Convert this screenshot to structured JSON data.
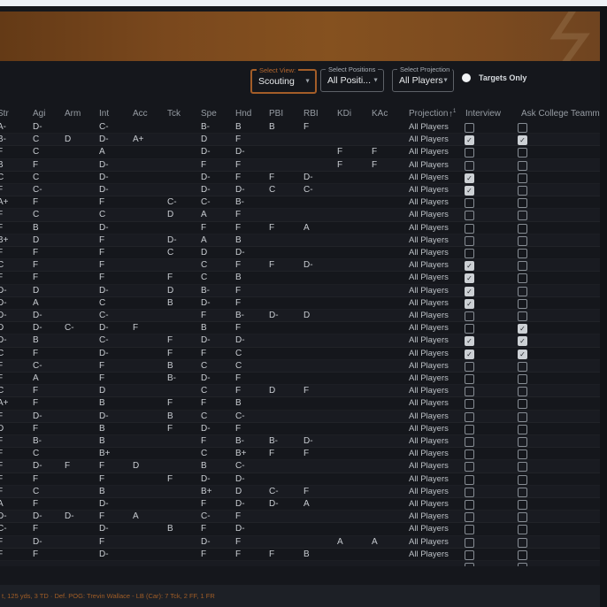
{
  "toolbar": {
    "select_view": {
      "label": "Select View:",
      "value": "Scouting"
    },
    "select_positions": {
      "label": "Select Positions",
      "value": "All Positi..."
    },
    "select_projection": {
      "label": "Select Projection",
      "value": "All Players"
    },
    "targets_only_label": "Targets Only"
  },
  "table": {
    "columns": [
      "Str",
      "Agi",
      "Arm",
      "Int",
      "Acc",
      "Tck",
      "Spe",
      "Hnd",
      "PBI",
      "RBI",
      "KDi",
      "KAc",
      "Projection"
    ],
    "sort_arrow": "↑",
    "sort_priority": "1",
    "interview_label": "Interview",
    "ask_label": "Ask College Teammates",
    "projection_value": "All Players",
    "rows": [
      {
        "g": [
          "A-",
          "D-",
          "",
          "C-",
          "",
          "",
          "B-",
          "B",
          "B",
          "F",
          "",
          ""
        ],
        "iv": false,
        "ask": false
      },
      {
        "g": [
          "B-",
          "C",
          "D",
          "D-",
          "A+",
          "",
          "D",
          "F",
          "",
          "",
          "",
          ""
        ],
        "iv": true,
        "ask": true
      },
      {
        "g": [
          "F",
          "C",
          "",
          "A",
          "",
          "",
          "D-",
          "D-",
          "",
          "",
          "F",
          "F"
        ],
        "iv": false,
        "ask": false
      },
      {
        "g": [
          "B",
          "F",
          "",
          "D-",
          "",
          "",
          "F",
          "F",
          "",
          "",
          "F",
          "F"
        ],
        "iv": false,
        "ask": false
      },
      {
        "g": [
          "C",
          "C",
          "",
          "D-",
          "",
          "",
          "D-",
          "F",
          "F",
          "D-",
          "",
          ""
        ],
        "iv": true,
        "ask": false
      },
      {
        "g": [
          "F",
          "C-",
          "",
          "D-",
          "",
          "",
          "D-",
          "D-",
          "C",
          "C-",
          "",
          ""
        ],
        "iv": true,
        "ask": false
      },
      {
        "g": [
          "A+",
          "F",
          "",
          "F",
          "",
          "C-",
          "C-",
          "B-",
          "",
          "",
          "",
          ""
        ],
        "iv": false,
        "ask": false
      },
      {
        "g": [
          "F",
          "C",
          "",
          "C",
          "",
          "D",
          "A",
          "F",
          "",
          "",
          "",
          ""
        ],
        "iv": false,
        "ask": false
      },
      {
        "g": [
          "F",
          "B",
          "",
          "D-",
          "",
          "",
          "F",
          "F",
          "F",
          "A",
          "",
          ""
        ],
        "iv": false,
        "ask": false
      },
      {
        "g": [
          "B+",
          "D",
          "",
          "F",
          "",
          "D-",
          "A",
          "B",
          "",
          "",
          "",
          ""
        ],
        "iv": false,
        "ask": false
      },
      {
        "g": [
          "F",
          "F",
          "",
          "F",
          "",
          "C",
          "D",
          "D-",
          "",
          "",
          "",
          ""
        ],
        "iv": false,
        "ask": false
      },
      {
        "g": [
          "C",
          "F",
          "",
          "F",
          "",
          "",
          "C",
          "F",
          "F",
          "D-",
          "",
          ""
        ],
        "iv": true,
        "ask": false
      },
      {
        "g": [
          "F",
          "F",
          "",
          "F",
          "",
          "F",
          "C",
          "B",
          "",
          "",
          "",
          ""
        ],
        "iv": true,
        "ask": false
      },
      {
        "g": [
          "D-",
          "D",
          "",
          "D-",
          "",
          "D",
          "B-",
          "F",
          "",
          "",
          "",
          ""
        ],
        "iv": true,
        "ask": false
      },
      {
        "g": [
          "D-",
          "A",
          "",
          "C",
          "",
          "B",
          "D-",
          "F",
          "",
          "",
          "",
          ""
        ],
        "iv": true,
        "ask": false
      },
      {
        "g": [
          "D-",
          "D-",
          "",
          "C-",
          "",
          "",
          "F",
          "B-",
          "D-",
          "D",
          "",
          ""
        ],
        "iv": false,
        "ask": false
      },
      {
        "g": [
          "D",
          "D-",
          "C-",
          "D-",
          "F",
          "",
          "B",
          "F",
          "",
          "",
          "",
          ""
        ],
        "iv": false,
        "ask": true
      },
      {
        "g": [
          "D-",
          "B",
          "",
          "C-",
          "",
          "F",
          "D-",
          "D-",
          "",
          "",
          "",
          ""
        ],
        "iv": true,
        "ask": true
      },
      {
        "g": [
          "C",
          "F",
          "",
          "D-",
          "",
          "F",
          "F",
          "C",
          "",
          "",
          "",
          ""
        ],
        "iv": true,
        "ask": true
      },
      {
        "g": [
          "F",
          "C-",
          "",
          "F",
          "",
          "B",
          "C",
          "C",
          "",
          "",
          "",
          ""
        ],
        "iv": false,
        "ask": false
      },
      {
        "g": [
          "F",
          "A",
          "",
          "F",
          "",
          "B-",
          "D-",
          "F",
          "",
          "",
          "",
          ""
        ],
        "iv": false,
        "ask": false
      },
      {
        "g": [
          "C",
          "F",
          "",
          "D",
          "",
          "",
          "C",
          "F",
          "D",
          "F",
          "",
          ""
        ],
        "iv": false,
        "ask": false
      },
      {
        "g": [
          "A+",
          "F",
          "",
          "B",
          "",
          "F",
          "F",
          "B",
          "",
          "",
          "",
          ""
        ],
        "iv": false,
        "ask": false
      },
      {
        "g": [
          "F",
          "D-",
          "",
          "D-",
          "",
          "B",
          "C",
          "C-",
          "",
          "",
          "",
          ""
        ],
        "iv": false,
        "ask": false
      },
      {
        "g": [
          "D",
          "F",
          "",
          "B",
          "",
          "F",
          "D-",
          "F",
          "",
          "",
          "",
          ""
        ],
        "iv": false,
        "ask": false
      },
      {
        "g": [
          "F",
          "B-",
          "",
          "B",
          "",
          "",
          "F",
          "B-",
          "B-",
          "D-",
          "",
          ""
        ],
        "iv": false,
        "ask": false
      },
      {
        "g": [
          "F",
          "C",
          "",
          "B+",
          "",
          "",
          "C",
          "B+",
          "F",
          "F",
          "",
          ""
        ],
        "iv": false,
        "ask": false
      },
      {
        "g": [
          "F",
          "D-",
          "F",
          "F",
          "D",
          "",
          "B",
          "C-",
          "",
          "",
          "",
          ""
        ],
        "iv": false,
        "ask": false
      },
      {
        "g": [
          "F",
          "F",
          "",
          "F",
          "",
          "F",
          "D-",
          "D-",
          "",
          "",
          "",
          ""
        ],
        "iv": false,
        "ask": false
      },
      {
        "g": [
          "F",
          "C",
          "",
          "B",
          "",
          "",
          "B+",
          "D",
          "C-",
          "F",
          "",
          ""
        ],
        "iv": false,
        "ask": false
      },
      {
        "g": [
          "A",
          "F",
          "",
          "D-",
          "",
          "",
          "F",
          "D-",
          "D-",
          "A",
          "",
          ""
        ],
        "iv": false,
        "ask": false
      },
      {
        "g": [
          "D-",
          "D-",
          "D-",
          "F",
          "A",
          "",
          "C-",
          "F",
          "",
          "",
          "",
          ""
        ],
        "iv": false,
        "ask": false
      },
      {
        "g": [
          "C-",
          "F",
          "",
          "D-",
          "",
          "B",
          "F",
          "D-",
          "",
          "",
          "",
          ""
        ],
        "iv": false,
        "ask": false
      },
      {
        "g": [
          "F",
          "D-",
          "",
          "F",
          "",
          "",
          "D-",
          "F",
          "",
          "",
          "A",
          "A"
        ],
        "iv": false,
        "ask": false
      },
      {
        "g": [
          "F",
          "F",
          "",
          "D-",
          "",
          "",
          "F",
          "F",
          "F",
          "B",
          "",
          ""
        ],
        "iv": false,
        "ask": false
      },
      {
        "g": [
          "",
          "",
          "",
          "",
          "",
          "",
          "",
          "",
          "",
          "",
          "",
          ""
        ],
        "iv": false,
        "ask": false
      }
    ]
  },
  "footer": {
    "ticker": "t, 125 yds, 3 TD · Def. POG: Trevin Wallace - LB (Car): 7 Tck, 2 FF, 1 FR"
  },
  "colors": {
    "accent_orange": "#a35d28",
    "banner_brown": "#7a481d",
    "app_bg": "#15171c",
    "ticker_text": "#a05d26"
  }
}
